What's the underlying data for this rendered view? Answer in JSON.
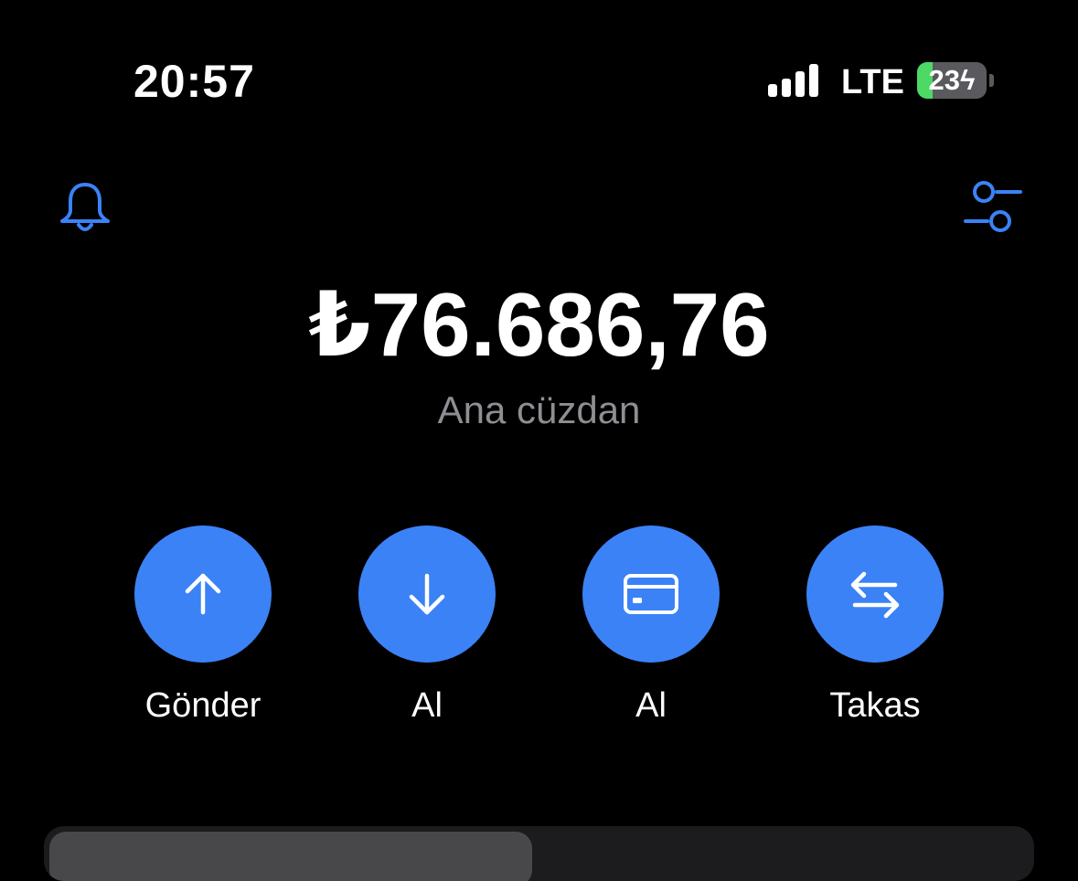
{
  "status_bar": {
    "time": "20:57",
    "network": "LTE",
    "battery_level": "23",
    "battery_percent": 23,
    "charging": true
  },
  "header": {
    "notifications_icon": "bell-icon",
    "settings_icon": "sliders-icon",
    "accent_color": "#3b82f6"
  },
  "wallet": {
    "balance": "₺76.686,76",
    "name": "Ana cüzdan"
  },
  "actions": [
    {
      "label": "Gönder",
      "icon": "arrow-up-icon"
    },
    {
      "label": "Al",
      "icon": "arrow-down-icon"
    },
    {
      "label": "Al",
      "icon": "credit-card-icon"
    },
    {
      "label": "Takas",
      "icon": "swap-arrows-icon"
    }
  ],
  "colors": {
    "background": "#000000",
    "action_button": "#3b82f6",
    "secondary_text": "#8e8e93",
    "battery_fill": "#4cd964"
  }
}
